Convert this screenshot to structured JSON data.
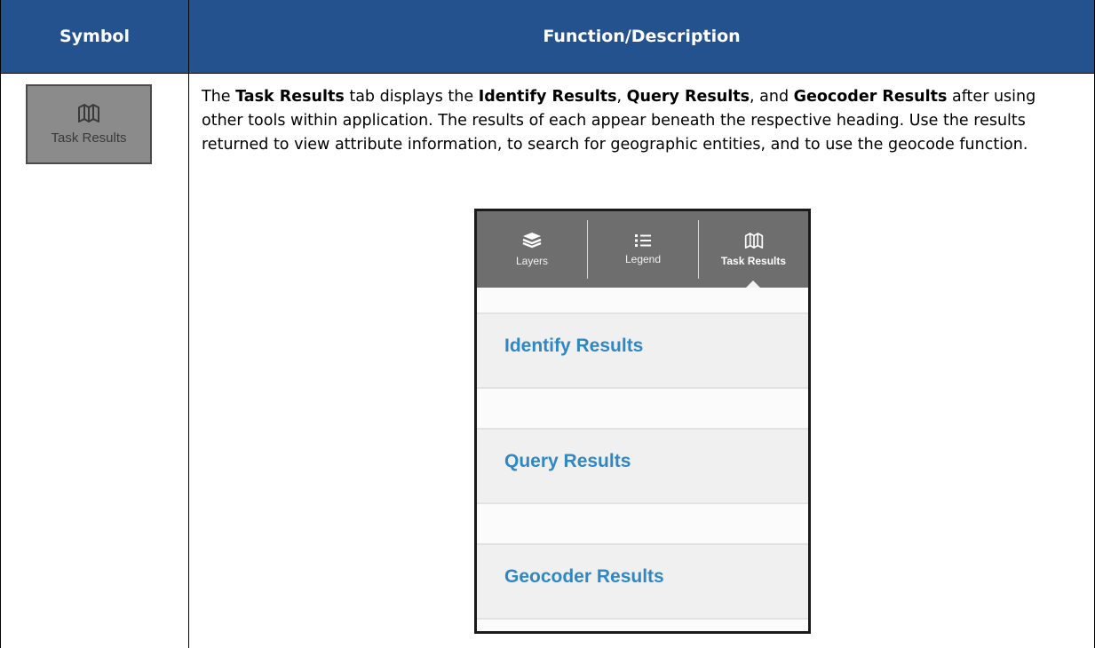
{
  "table": {
    "header": {
      "symbol": "Symbol",
      "function": "Function/Description"
    },
    "row": {
      "symbol_icon": "map-icon",
      "symbol_label": "Task Results",
      "description": {
        "p1_text1": "The ",
        "p1_bold1": "Task Results",
        "p1_text2": " tab displays the ",
        "p1_bold2": "Identify Results",
        "p1_text3": ", ",
        "p1_bold3": "Query Results",
        "p1_text4": ", and ",
        "p1_bold4": "Geocoder Results",
        "p1_text5": " after using other tools within application. The results of each appear beneath the respective heading. Use the results returned to view attribute information, to search for geographic entities, and to use the geocode function."
      }
    }
  },
  "panel": {
    "tabs": [
      {
        "label": "Layers",
        "icon": "layers-icon"
      },
      {
        "label": "Legend",
        "icon": "list-icon"
      },
      {
        "label": "Task Results",
        "icon": "map-icon",
        "active": true
      }
    ],
    "sections": [
      {
        "heading": "Identify Results"
      },
      {
        "heading": "Query Results"
      },
      {
        "heading": "Geocoder Results"
      }
    ]
  },
  "colors": {
    "header_bg": "#23528f",
    "heading_blue": "#2f87c4",
    "tab_bar": "#6e6e6e"
  }
}
